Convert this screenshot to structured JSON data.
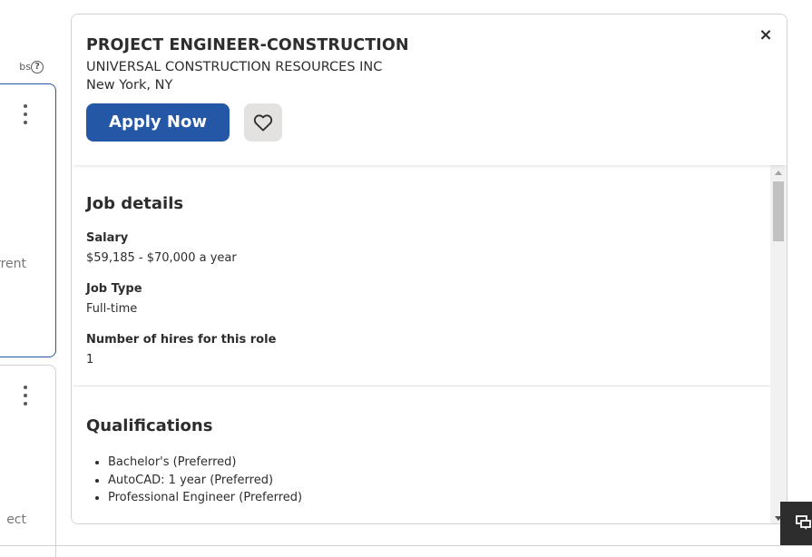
{
  "left_list": {
    "help_text": "bs",
    "help_icon_glyph": "?",
    "card1_partial_text": "rrent",
    "card2_partial_text": "ect"
  },
  "job": {
    "title": "PROJECT ENGINEER-CONSTRUCTION",
    "company": "UNIVERSAL CONSTRUCTION RESOURCES INC",
    "location": "New York, NY",
    "apply_label": "Apply Now",
    "close_glyph": "×"
  },
  "details": {
    "heading": "Job details",
    "salary_label": "Salary",
    "salary_value": "$59,185 - $70,000 a year",
    "jobtype_label": "Job Type",
    "jobtype_value": "Full-time",
    "hires_label": "Number of hires for this role",
    "hires_value": "1"
  },
  "qualifications": {
    "heading": "Qualifications",
    "items": [
      "Bachelor's (Preferred)",
      "AutoCAD: 1 year (Preferred)",
      "Professional Engineer (Preferred)"
    ]
  },
  "colors": {
    "accent": "#2557a7",
    "text": "#2d2d2d",
    "save_bg": "#e4e2e0"
  },
  "icons": {
    "save": "heart-icon",
    "close": "close-icon",
    "help": "help-circle-icon",
    "more": "kebab-icon",
    "chat": "chat-icon"
  }
}
